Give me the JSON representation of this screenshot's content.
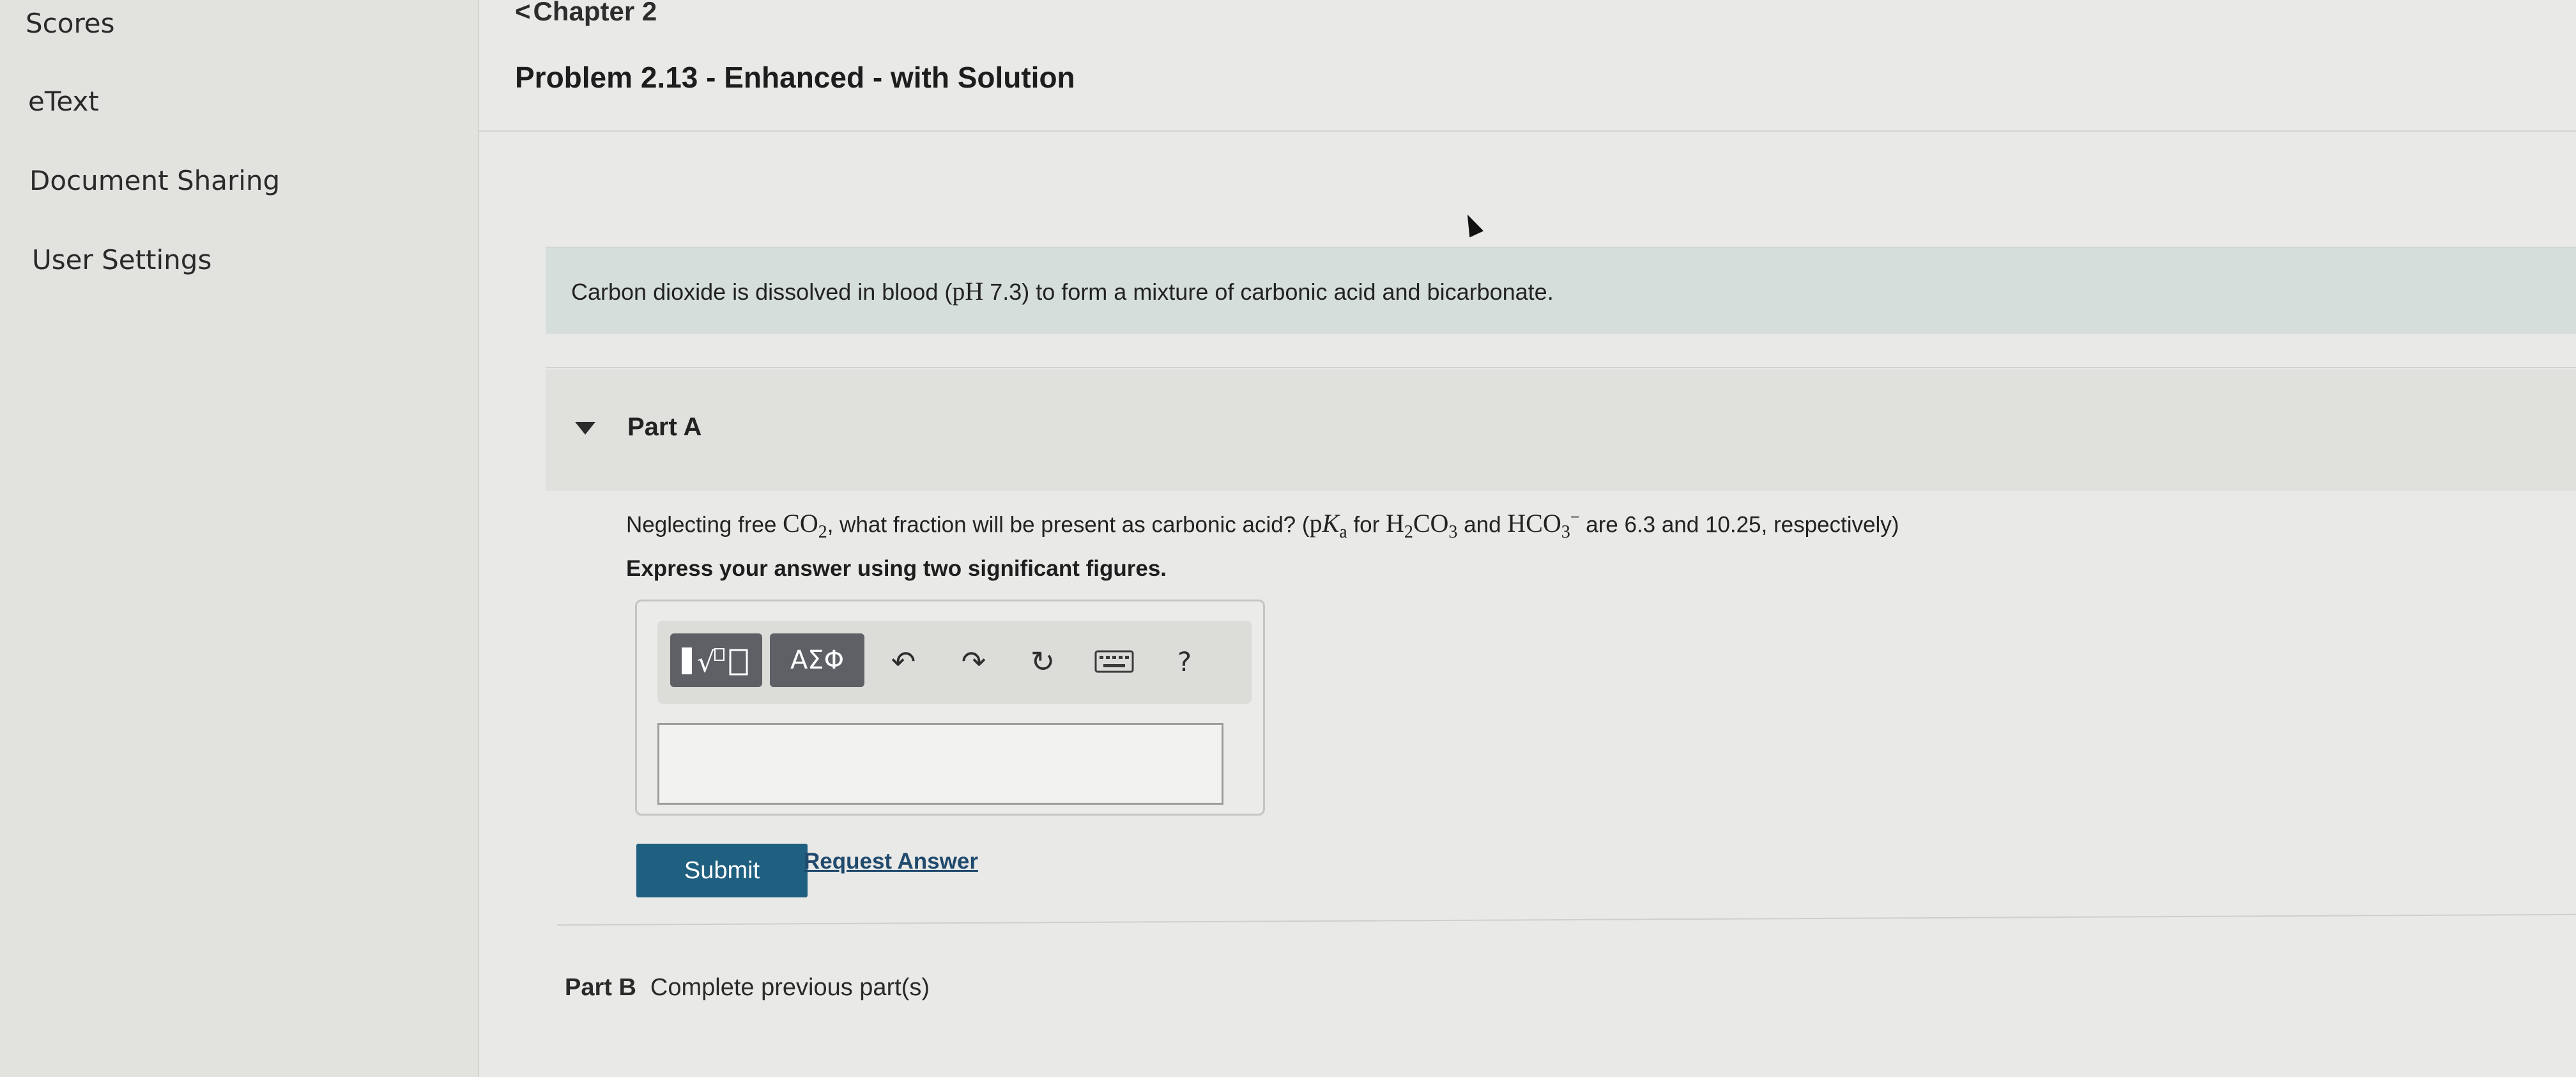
{
  "sidebar": {
    "items": [
      {
        "label": "Scores"
      },
      {
        "label": "eText"
      },
      {
        "label": "Document Sharing"
      },
      {
        "label": "User Settings"
      }
    ]
  },
  "header": {
    "back_label": "Chapter 2",
    "title": "Problem 2.13 - Enhanced - with Solution"
  },
  "intro": {
    "before": "Carbon dioxide is dissolved in blood (",
    "ph": "pH",
    "after": " 7.3) to form a mixture of carbonic acid and bicarbonate."
  },
  "part_a": {
    "label": "Part A",
    "question": {
      "t1": "Neglecting free ",
      "co2": "CO",
      "co2_sub": "2",
      "t2": ", what fraction will be present as carbonic acid? (",
      "pka_p": "p",
      "pka_k": "K",
      "pka_sub": "a",
      "t3": " for ",
      "h2co3_h": "H",
      "h2co3_sub1": "2",
      "h2co3_co": "CO",
      "h2co3_sub2": "3",
      "t4": " and ",
      "hco3": "HCO",
      "hco3_sub": "3",
      "hco3_sup": "−",
      "t5": " are 6.3 and 10.25, respectively)"
    },
    "instruction": "Express your answer using two significant figures.",
    "toolbar": {
      "greek_label": "ΑΣΦ",
      "help_label": "?"
    },
    "submit_label": "Submit",
    "request_label": "Request Answer"
  },
  "part_b": {
    "label": "Part B",
    "status": "Complete previous part(s)"
  },
  "colors": {
    "submit": "#1f5f80",
    "link": "#204a6e",
    "intro_bg": "#d6dedc"
  }
}
